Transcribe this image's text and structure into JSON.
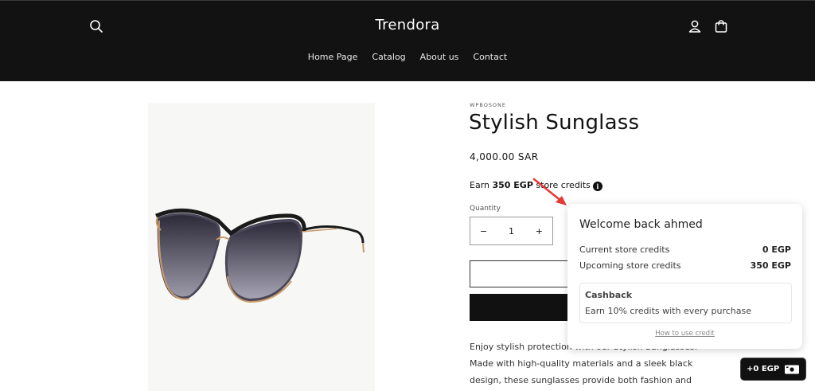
{
  "header": {
    "brand": "Trendora",
    "nav": [
      "Home Page",
      "Catalog",
      "About us",
      "Contact"
    ],
    "icons": [
      "search-icon",
      "account-icon",
      "cart-icon"
    ]
  },
  "product": {
    "vendor": "WPBOSONE",
    "title": "Stylish Sunglass",
    "price": "4,000.00 SAR",
    "earn_prefix": "Earn",
    "earn_amount": "350 EGP",
    "earn_suffix": "store credits",
    "quantity_label": "Quantity",
    "quantity_value": "1",
    "description": "Enjoy stylish protection with our Stylish Sunglasses. Made with high-quality materials and a sleek black design, these sunglasses provide both fashion and"
  },
  "popup": {
    "title": "Welcome back ahmed",
    "current_label": "Current store credits",
    "current_value": "0 EGP",
    "upcoming_label": "Upcoming store credits",
    "upcoming_value": "350 EGP",
    "cashback_title": "Cashback",
    "cashback_text": "Earn 10% credits with every purchase",
    "howto": "How to use credit"
  },
  "credits_pill": {
    "label": "+0 EGP"
  },
  "colors": {
    "header_bg": "#121212",
    "arrow": "#e53935"
  }
}
